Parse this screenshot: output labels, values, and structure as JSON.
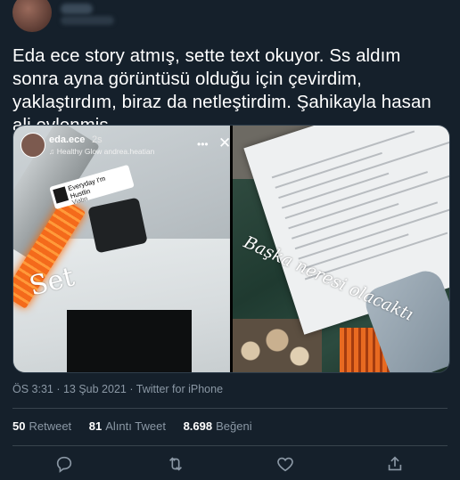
{
  "tweet": {
    "text": "Eda ece story atmış, sette text okuyor. Ss aldım sonra ayna görüntüsü olduğu için çevirdim, yaklaştırdım, biraz da netleştirdim. Şahikayla hasan ali evlenmiş...",
    "timestamp": "ÖS 3:31 · 13 Şub 2021 · Twitter for iPhone"
  },
  "story": {
    "username": "eda.ece",
    "time": "2s",
    "subtitle": "♫ Healthy Glow andrea.heatian",
    "music_title": "Everyday I'm Hustlin",
    "music_artist": "Viabn",
    "overlay_text": "Set",
    "more_glyph": "•••",
    "close_glyph": "✕"
  },
  "script_photo": {
    "overlay_text": "Başka neresi olacaktı"
  },
  "stats": {
    "retweets": "50",
    "retweets_label": "Retweet",
    "quotes": "81",
    "quotes_label": "Alıntı Tweet",
    "likes": "8.698",
    "likes_label": "Beğeni"
  },
  "actions": {
    "reply_icon": "reply-icon",
    "retweet_icon": "retweet-icon",
    "like_icon": "like-icon",
    "share_icon": "share-icon",
    "icon_color": "#8b98a5"
  },
  "colors": {
    "background": "#15202b",
    "text": "#ffffff",
    "muted": "#8b98a5",
    "divider": "#38444d"
  }
}
